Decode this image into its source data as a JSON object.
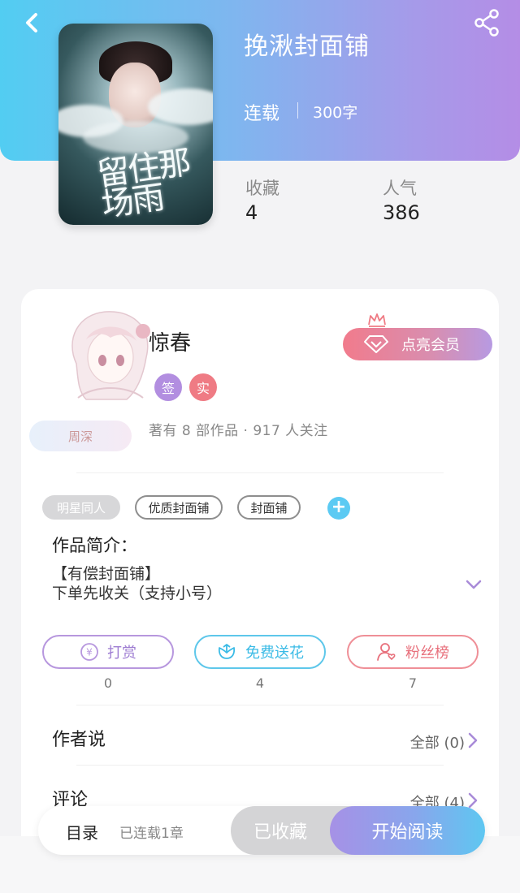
{
  "book": {
    "title": "挽湫封面铺",
    "status": "连载",
    "word_count": "300字",
    "cover_title": "留住那场雨",
    "stats": [
      {
        "label": "收藏",
        "value": "4"
      },
      {
        "label": "人气",
        "value": "386"
      }
    ]
  },
  "author": {
    "name": "惊春",
    "badges": [
      "签",
      "实"
    ],
    "info": "著有 8 部作品 · 917 人关注",
    "name_plate": "周深",
    "vip_button": "点亮会员"
  },
  "tags": [
    "明星同人",
    "优质封面铺",
    "封面铺"
  ],
  "intro": {
    "title": "作品简介：",
    "lines": [
      "【有偿封面铺】",
      "下单先收关（支持小号）"
    ]
  },
  "actions": [
    {
      "label": "打赏",
      "count": "0",
      "icon": "yen-coin-icon"
    },
    {
      "label": "免费送花",
      "count": "4",
      "icon": "flower-icon"
    },
    {
      "label": "粉丝榜",
      "count": "7",
      "icon": "fans-icon"
    }
  ],
  "sections": [
    {
      "title": "作者说",
      "more": "全部 (0)"
    },
    {
      "title": "评论",
      "more": "全部 (4)"
    }
  ],
  "bottom_bar": {
    "toc_label": "目录",
    "toc_sub": "已连载1章",
    "collected": "已收藏",
    "read": "开始阅读"
  },
  "colors": {
    "header_gradient_start": "#52cdf2",
    "header_gradient_end": "#b48de6",
    "accent_purple": "#a691e6",
    "accent_blue": "#5ec7f1",
    "accent_pink": "#f17b8c"
  }
}
